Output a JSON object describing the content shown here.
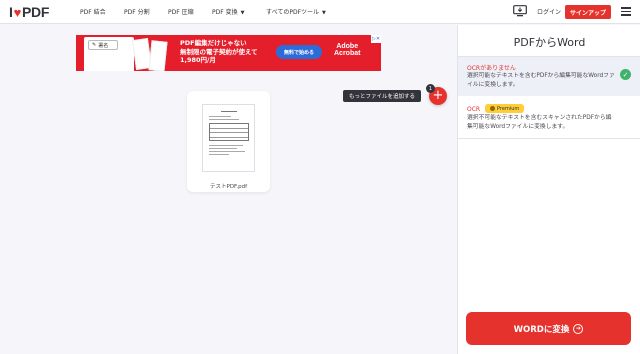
{
  "nav": {
    "logo_left": "I",
    "logo_heart": "♥",
    "logo_right": "PDF",
    "items": [
      {
        "label": "PDF 結合"
      },
      {
        "label": "PDF 分割"
      },
      {
        "label": "PDF 圧縮"
      },
      {
        "label": "PDF 変換",
        "dropdown": true
      },
      {
        "label": "すべてのPDFツール",
        "dropdown": true
      }
    ],
    "login": "ログイン",
    "signup": "サインアップ"
  },
  "ad": {
    "sign_label": "署名",
    "headline_lines": [
      "PDF編集だけじゃない",
      "無制限の電子契約が使えて",
      "1,980円/月"
    ],
    "cta": "無料で始める",
    "brand_line1": "Adobe",
    "brand_line2": "Acrobat"
  },
  "file": {
    "name": "テストPDF.pdf"
  },
  "add_more": {
    "tooltip": "もっとファイルを追加する",
    "count": "1"
  },
  "sidebar": {
    "title": "PDFからWord",
    "options": [
      {
        "title": "OCRがありません",
        "description": "選択可能なテキストを含むPDFから編集可能なWordファイルに変換します。",
        "selected": true
      },
      {
        "title": "OCR",
        "badge": "Premium",
        "description": "選択不可能なテキストを含むスキャンされたPDFから編集可能なWordファイルに変換します。",
        "selected": false
      }
    ],
    "convert_button": "WORDに変換"
  },
  "colors": {
    "brand_red": "#e5322d",
    "premium_yellow": "#ffcd37",
    "check_green": "#3fb36b"
  }
}
